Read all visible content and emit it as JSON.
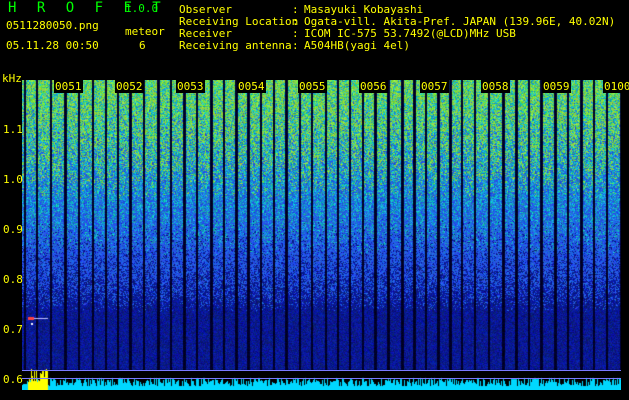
{
  "header": {
    "app_title": "H R O F F T",
    "version": "1.0.0",
    "filename": "0511280050.png",
    "datetime": "05.11.28 00:50",
    "mode_label": "meteor",
    "mode_count": "6"
  },
  "info": [
    {
      "label": "Observer",
      "value": "Masayuki Kobayashi"
    },
    {
      "label": "Receiving Location",
      "value": "Ogata-vill. Akita-Pref. JAPAN (139.96E, 40.02N)"
    },
    {
      "label": "Receiver",
      "value": "ICOM IC-575 53.7492(@LCD)MHz USB"
    },
    {
      "label": "Receiving antenna",
      "value": "A504HB(yagi 4el)"
    }
  ],
  "axis": {
    "unit": "kHz",
    "y_ticks": [
      "1.1",
      "1.0",
      "0.9",
      "0.8",
      "0.7",
      "0.6"
    ],
    "time_ticks": [
      "0051",
      "0052",
      "0053",
      "0054",
      "0055",
      "0056",
      "0057",
      "0058",
      "0059",
      "0100"
    ]
  },
  "colors": {
    "background": "#000000",
    "label": "#ffff00",
    "signal_low": "#0a1a8a",
    "signal_mid": "#2c6cff",
    "signal_high": "#5fd34a",
    "baseline": "#00d8ff"
  }
}
